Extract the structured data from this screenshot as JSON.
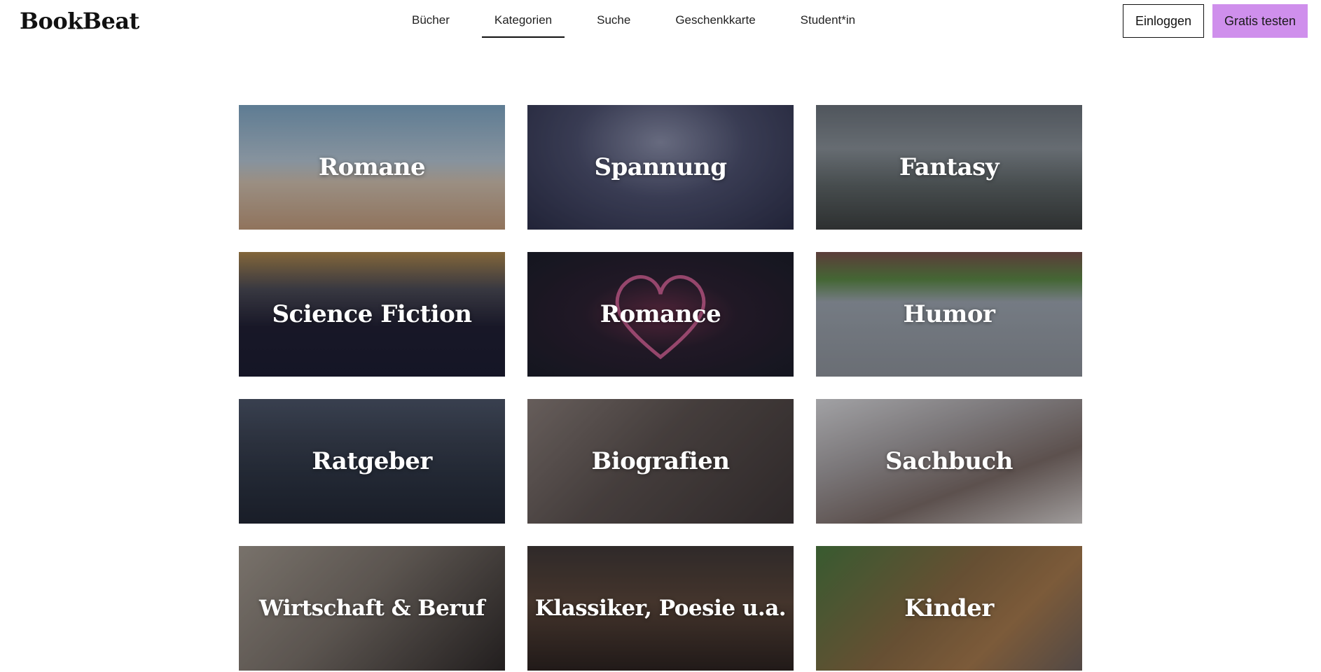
{
  "header": {
    "logo": "BookBeat",
    "nav": [
      {
        "label": "Bücher",
        "active": false
      },
      {
        "label": "Kategorien",
        "active": true
      },
      {
        "label": "Suche",
        "active": false
      },
      {
        "label": "Geschenkkarte",
        "active": false
      },
      {
        "label": "Student*in",
        "active": false
      }
    ],
    "login_label": "Einloggen",
    "trial_label": "Gratis testen"
  },
  "colors": {
    "trial_button": "#cf8fec",
    "text": "#111111",
    "background": "#ffffff"
  },
  "categories": [
    {
      "label": "Romane"
    },
    {
      "label": "Spannung"
    },
    {
      "label": "Fantasy"
    },
    {
      "label": "Science Fiction"
    },
    {
      "label": "Romance"
    },
    {
      "label": "Humor"
    },
    {
      "label": "Ratgeber"
    },
    {
      "label": "Biografien"
    },
    {
      "label": "Sachbuch"
    },
    {
      "label": "Wirtschaft & Beruf"
    },
    {
      "label": "Klassiker, Poesie u.a."
    },
    {
      "label": "Kinder"
    }
  ]
}
